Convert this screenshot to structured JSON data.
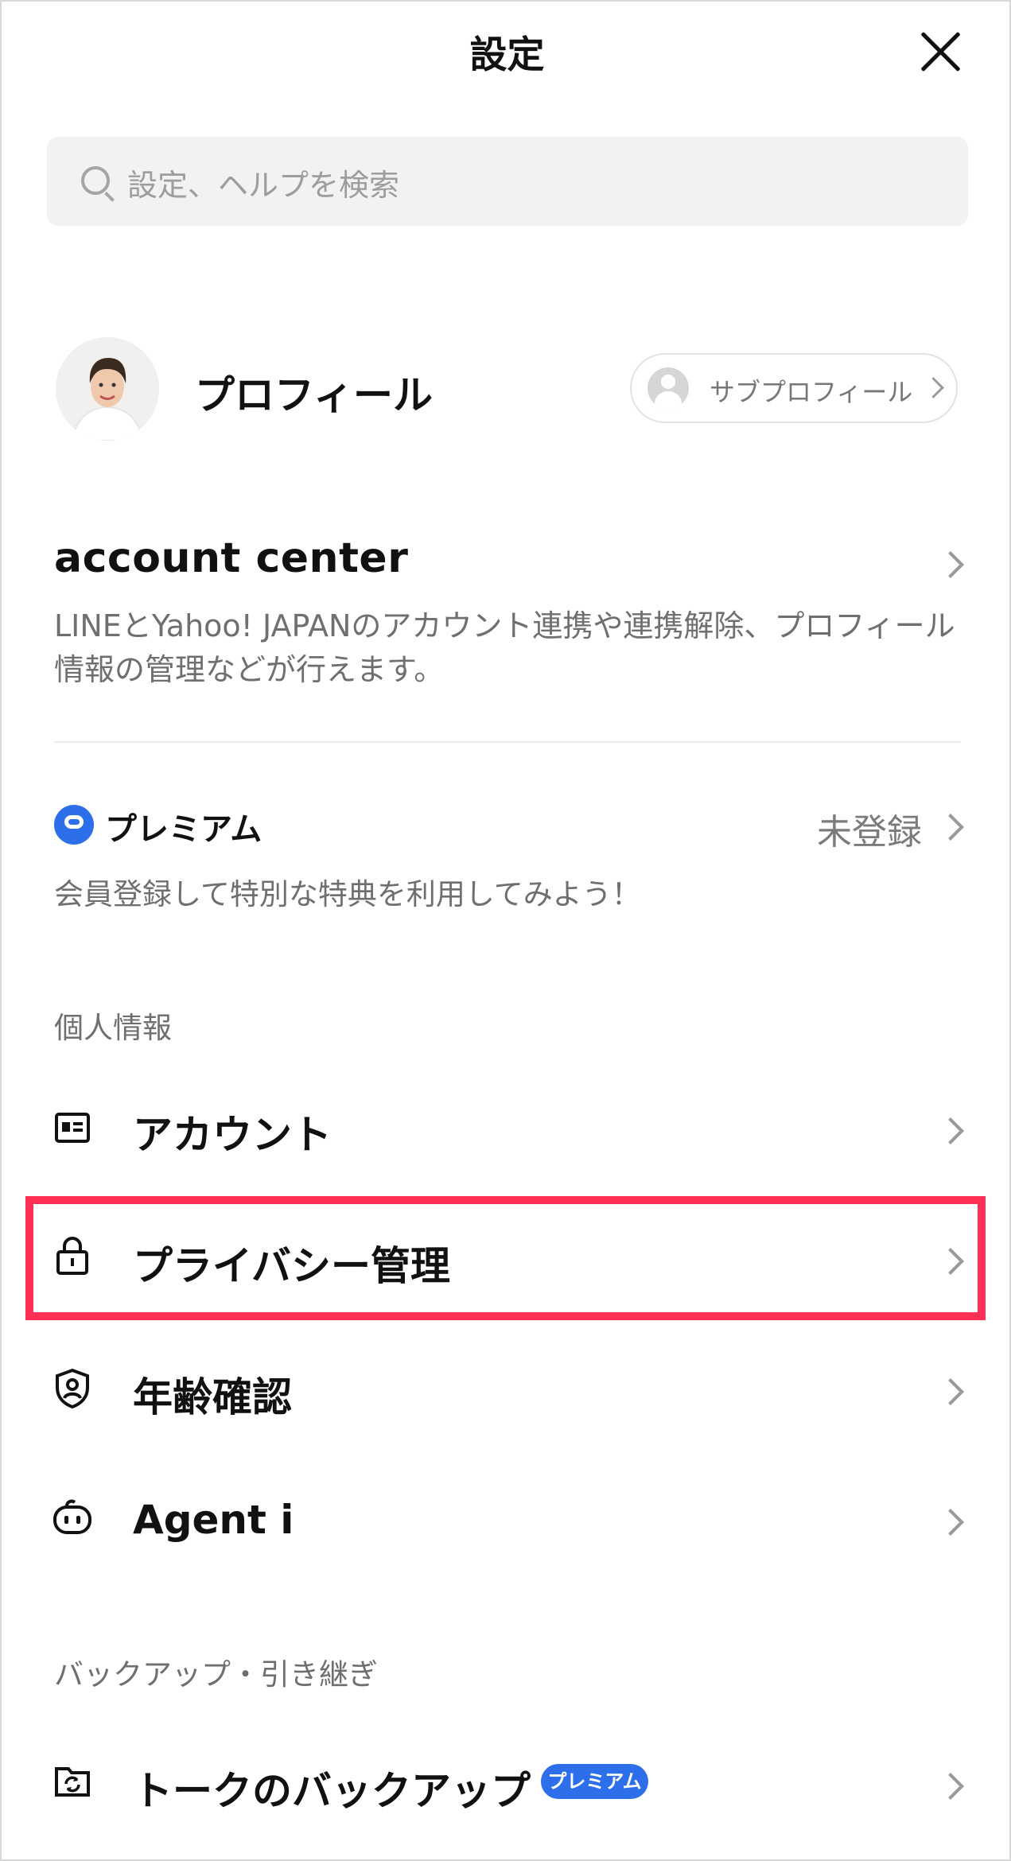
{
  "header": {
    "title": "設定",
    "close_icon": "close-icon"
  },
  "search": {
    "placeholder": "設定、ヘルプを検索"
  },
  "profile": {
    "name": "プロフィール",
    "sub_profile_label": "サブプロフィール"
  },
  "account_center": {
    "title": "account center",
    "description": "LINEとYahoo! JAPANのアカウント連携や連携解除、プロフィール情報の管理などが行えます。"
  },
  "premium": {
    "title": "プレミアム",
    "status": "未登録",
    "description": "会員登録して特別な特典を利用してみよう！"
  },
  "sections": {
    "personal": "個人情報",
    "backup": "バックアップ・引き継ぎ"
  },
  "items": {
    "account": "アカウント",
    "privacy": "プライバシー管理",
    "age": "年齢確認",
    "agent": "Agent i",
    "talk_backup": "トークのバックアップ",
    "talk_backup_badge": "プレミアム"
  },
  "colors": {
    "accent": "#2d6fea",
    "highlight": "#ff2f56"
  }
}
